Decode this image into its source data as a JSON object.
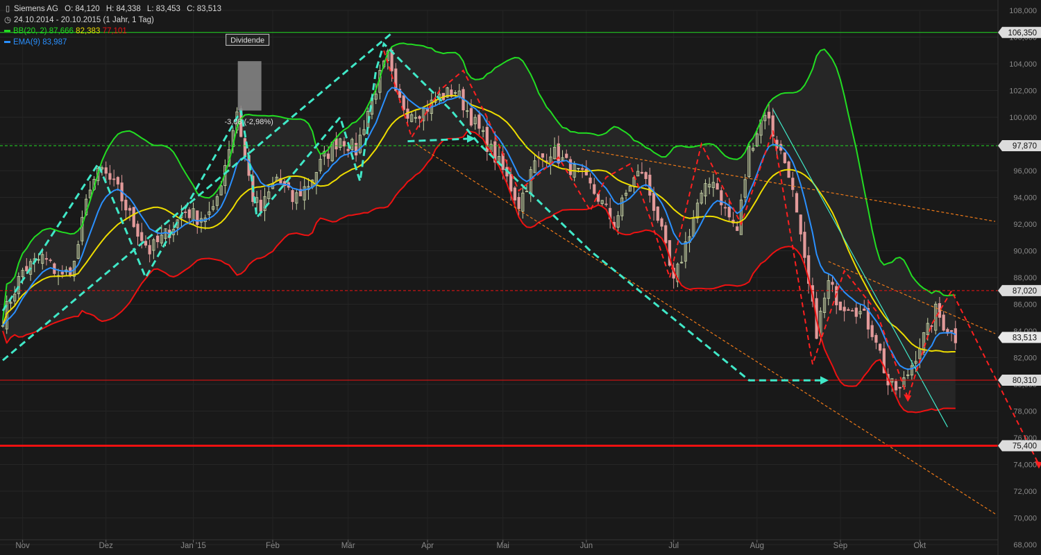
{
  "header": {
    "symbol": "Siemens AG",
    "ohlc": {
      "o": "O: 84,120",
      "h": "H: 84,338",
      "l": "L: 83,453",
      "c": "C: 83,513"
    },
    "range": "24.10.2014 - 20.10.2015 (1 Jahr, 1 Tag)",
    "bb_label": "BB(20, 2)",
    "bb_upper": "87,666",
    "bb_mid": "82,383",
    "bb_lower": "77,101",
    "ema_label": "EMA(9)",
    "ema_value": "83,987",
    "chart_icon": "candlestick-icon",
    "clock_icon": "clock-icon"
  },
  "colors": {
    "background": "#191919",
    "band_fill": "#262626",
    "upper_band": "#22dd22",
    "mid_band": "#eedd00",
    "lower_band": "#ee1111",
    "ema": "#2a90ff",
    "pattern_cyan": "#40e8c8",
    "pattern_red": "#ff2020",
    "trend_orange": "#f07a18",
    "candle_up": "#ccd8aa",
    "candle_down": "#e29a9a"
  },
  "chart_data": {
    "type": "candlestick",
    "y_axis": {
      "min": 68,
      "max": 108,
      "step": 2,
      "side": "right",
      "tick_labels": [
        "68,000",
        "70,000",
        "72,000",
        "74,000",
        "76,000",
        "78,000",
        "80,000",
        "82,000",
        "84,000",
        "86,000",
        "88,000",
        "90,000",
        "92,000",
        "94,000",
        "96,000",
        "98,000",
        "100,000",
        "102,000",
        "104,000",
        "106,000",
        "108,000"
      ]
    },
    "x_axis": {
      "months": [
        "Nov",
        "Dez",
        "Jan '15",
        "Feb",
        "Mär",
        "Apr",
        "Mai",
        "Jun",
        "Jul",
        "Aug",
        "Sep",
        "Okt"
      ],
      "month_index": [
        5,
        26,
        48,
        68,
        87,
        107,
        126,
        147,
        169,
        190,
        211,
        231
      ]
    },
    "bars_total": 250,
    "close_anchors": [
      [
        0,
        85.0
      ],
      [
        5,
        88.5
      ],
      [
        10,
        89.5
      ],
      [
        15,
        88.0
      ],
      [
        18,
        89.0
      ],
      [
        22,
        95.0
      ],
      [
        25,
        96.0
      ],
      [
        29,
        94.5
      ],
      [
        33,
        92.0
      ],
      [
        37,
        90.0
      ],
      [
        42,
        91.5
      ],
      [
        46,
        93.0
      ],
      [
        49,
        92.5
      ],
      [
        53,
        92.8
      ],
      [
        56,
        96.5
      ],
      [
        59,
        100.5
      ],
      [
        61,
        97.0
      ],
      [
        63,
        94.0
      ],
      [
        65,
        93.0
      ],
      [
        69,
        95.5
      ],
      [
        73,
        93.8
      ],
      [
        77,
        95.0
      ],
      [
        81,
        97.0
      ],
      [
        85,
        98.5
      ],
      [
        89,
        97.5
      ],
      [
        92,
        100.5
      ],
      [
        95,
        103.0
      ],
      [
        97,
        104.5
      ],
      [
        99,
        101.5
      ],
      [
        102,
        100.5
      ],
      [
        106,
        100.5
      ],
      [
        110,
        101.5
      ],
      [
        114,
        102.0
      ],
      [
        118,
        100.0
      ],
      [
        122,
        98.0
      ],
      [
        126,
        96.0
      ],
      [
        130,
        93.5
      ],
      [
        134,
        96.5
      ],
      [
        138,
        97.5
      ],
      [
        142,
        96.5
      ],
      [
        146,
        95.5
      ],
      [
        150,
        94.0
      ],
      [
        154,
        92.0
      ],
      [
        158,
        95.0
      ],
      [
        161,
        96.0
      ],
      [
        165,
        92.5
      ],
      [
        169,
        87.5
      ],
      [
        172,
        90.5
      ],
      [
        175,
        93.5
      ],
      [
        179,
        95.5
      ],
      [
        182,
        93.0
      ],
      [
        185,
        91.5
      ],
      [
        188,
        97.5
      ],
      [
        192,
        100.5
      ],
      [
        195,
        98.0
      ],
      [
        198,
        96.0
      ],
      [
        202,
        89.0
      ],
      [
        205,
        84.0
      ],
      [
        208,
        87.5
      ],
      [
        211,
        86.0
      ],
      [
        214,
        86.0
      ],
      [
        217,
        85.0
      ],
      [
        220,
        83.5
      ],
      [
        223,
        80.0
      ],
      [
        226,
        79.5
      ],
      [
        229,
        81.5
      ],
      [
        231,
        83.0
      ],
      [
        233,
        84.0
      ],
      [
        235,
        85.5
      ],
      [
        237,
        84.5
      ],
      [
        240,
        83.5
      ]
    ],
    "horizontal_levels": [
      {
        "value": 106.35,
        "label": "106,350",
        "style": "solid-thin",
        "color": "#22dd22"
      },
      {
        "value": 97.87,
        "label": "97,870",
        "style": "dashed",
        "color": "#22dd22"
      },
      {
        "value": 87.02,
        "label": "87,020",
        "style": "dashed",
        "color": "#ee1111"
      },
      {
        "value": 83.513,
        "label": "83,513",
        "style": "price",
        "color": "#d0d0d0"
      },
      {
        "value": 80.31,
        "label": "80,310",
        "style": "solid-thin",
        "color": "#ee1111"
      },
      {
        "value": 75.4,
        "label": "75,400",
        "style": "solid-thick",
        "color": "#ee1111"
      }
    ],
    "trend_lines": [
      {
        "color": "#f07a18",
        "from": [
          146,
          97.6
        ],
        "to": [
          250,
          92.2
        ]
      },
      {
        "color": "#f07a18",
        "from": [
          104,
          98.0
        ],
        "to": [
          250,
          70.3
        ]
      },
      {
        "color": "#f07a18",
        "from": [
          208,
          89.2
        ],
        "to": [
          250,
          83.8
        ]
      },
      {
        "color": "#40e8c8",
        "from": [
          194,
          100.6
        ],
        "to": [
          238,
          76.8
        ]
      }
    ],
    "patterns": {
      "cyan": [
        [
          [
            0,
            85.5
          ],
          [
            24,
            96.5
          ],
          [
            36,
            88.0
          ],
          [
            60,
            100.5
          ],
          [
            62,
            97.0
          ],
          [
            64,
            92.5
          ],
          [
            85,
            100.0
          ],
          [
            90,
            95.2
          ],
          [
            94,
            103.5
          ],
          [
            96,
            105.5
          ],
          [
            113,
            100.5
          ],
          [
            120,
            98.0
          ],
          [
            148,
            90.0
          ],
          [
            188,
            80.3
          ],
          [
            207,
            80.3
          ]
        ],
        [
          [
            0,
            81.8
          ],
          [
            98,
            106.3
          ]
        ],
        [
          [
            102,
            98.2
          ],
          [
            118,
            98.4
          ]
        ]
      ],
      "cyan_arrow_heads": [
        [
          207,
          80.3
        ],
        [
          118,
          98.4
        ]
      ],
      "red": [
        [
          [
            96,
            105.0
          ],
          [
            103,
            98.5
          ],
          [
            110,
            102.0
          ],
          [
            116,
            103.5
          ],
          [
            122,
            100.0
          ],
          [
            130,
            94.5
          ],
          [
            140,
            97.0
          ],
          [
            148,
            93.0
          ],
          [
            152,
            95.5
          ],
          [
            158,
            96.5
          ],
          [
            163,
            92.5
          ],
          [
            168,
            88.0
          ],
          [
            176,
            98.0
          ],
          [
            186,
            92.0
          ],
          [
            194,
            99.0
          ],
          [
            204,
            81.5
          ],
          [
            212,
            88.5
          ],
          [
            220,
            85.5
          ],
          [
            228,
            79.0
          ],
          [
            234,
            84.5
          ],
          [
            239,
            87.0
          ],
          [
            261,
            74.0
          ]
        ]
      ],
      "red_arrow_heads": [
        [
          228,
          79.0
        ],
        [
          261,
          74.0
        ]
      ]
    },
    "annotations": [
      {
        "text": "Dividende",
        "index": 62,
        "value": 105.8
      },
      {
        "text": "-3,08 (-2,98%)",
        "index": 62,
        "value": 99.7
      }
    ]
  }
}
